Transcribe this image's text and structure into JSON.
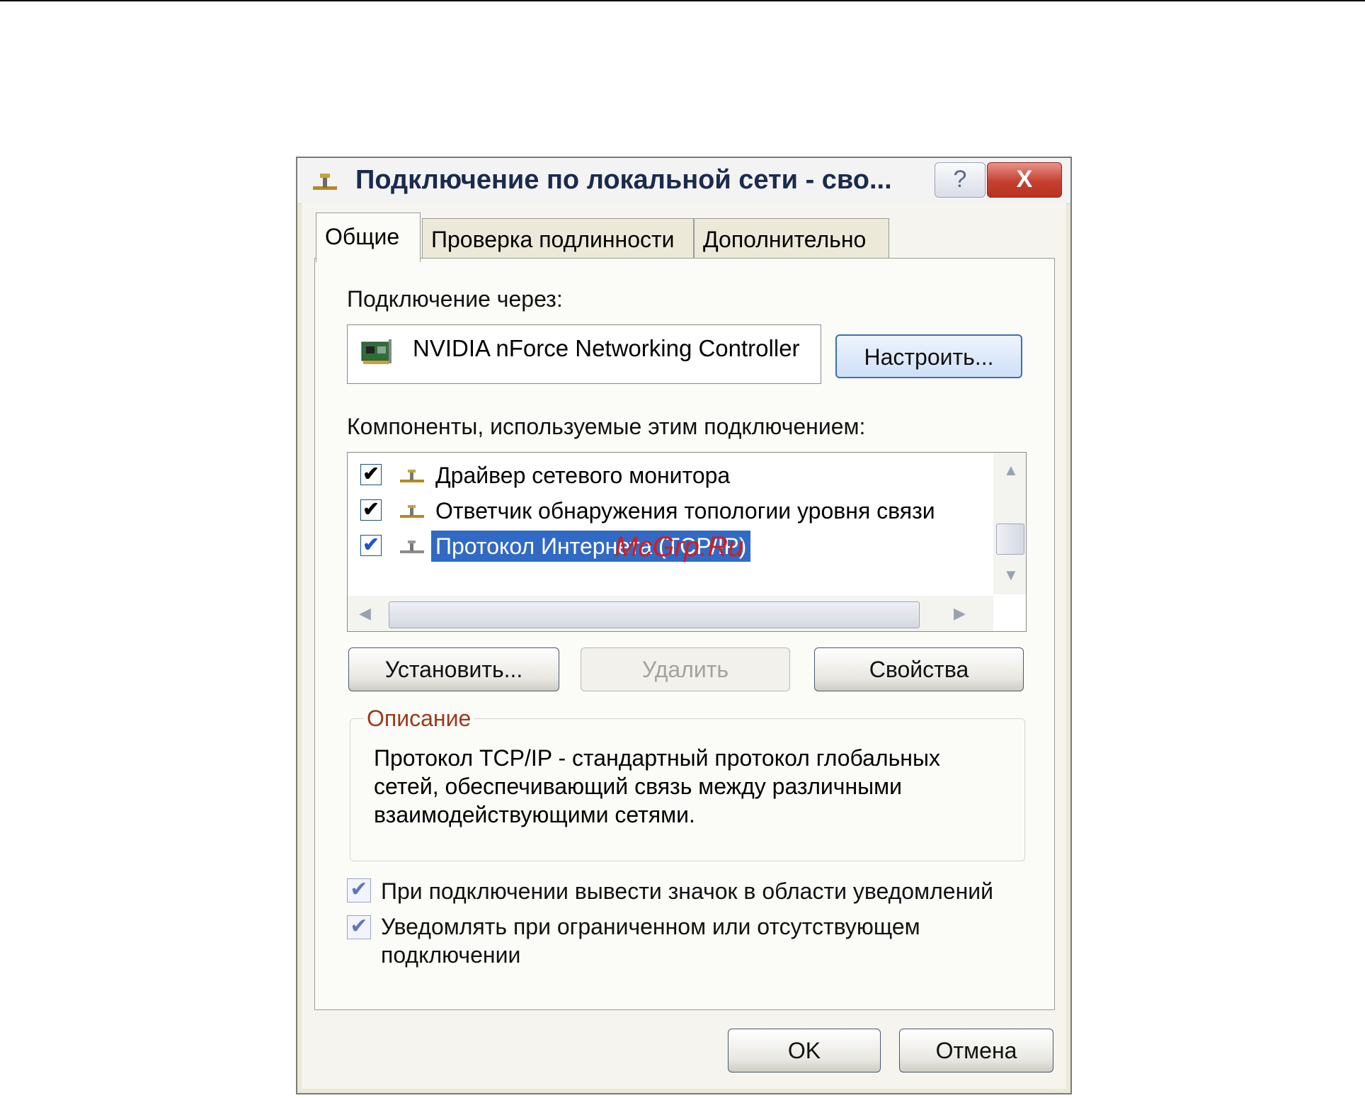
{
  "window": {
    "title": "Подключение по локальной сети - сво...",
    "help_label": "?",
    "close_label": "X"
  },
  "tabs": [
    {
      "label": "Общие",
      "active": true
    },
    {
      "label": "Проверка подлинности",
      "active": false
    },
    {
      "label": "Дополнительно",
      "active": false
    }
  ],
  "connect_via": {
    "label": "Подключение через:",
    "adapter": "NVIDIA nForce Networking Controller",
    "configure_button": "Настроить..."
  },
  "components": {
    "label": "Компоненты, используемые этим подключением:",
    "items": [
      {
        "label": "Драйвер сетевого монитора",
        "checked": true,
        "selected": false
      },
      {
        "label": "Ответчик обнаружения топологии уровня связи",
        "checked": true,
        "selected": false
      },
      {
        "label": "Протокол Интернета (TCP/IP)",
        "checked": true,
        "selected": true
      }
    ]
  },
  "actions": {
    "install": "Установить...",
    "remove": "Удалить",
    "properties": "Свойства"
  },
  "description": {
    "legend": "Описание",
    "text_lines": [
      "Протокол TCP/IP - стандартный протокол глобальных",
      "сетей, обеспечивающий связь между различными",
      "взаимодействующими сетями."
    ]
  },
  "options": {
    "show_icon": "При подключении вывести значок в области уведомлений",
    "notify_line1": "Уведомлять при ограниченном или отсутствующем",
    "notify_line2": "подключении"
  },
  "footer": {
    "ok": "OK",
    "cancel": "Отмена"
  },
  "watermark": "McGrp.Ru",
  "colors": {
    "selection": "#316ac5",
    "legend": "#9b3a1a",
    "close_button": "#c4402f",
    "watermark": "#d81b1b"
  }
}
